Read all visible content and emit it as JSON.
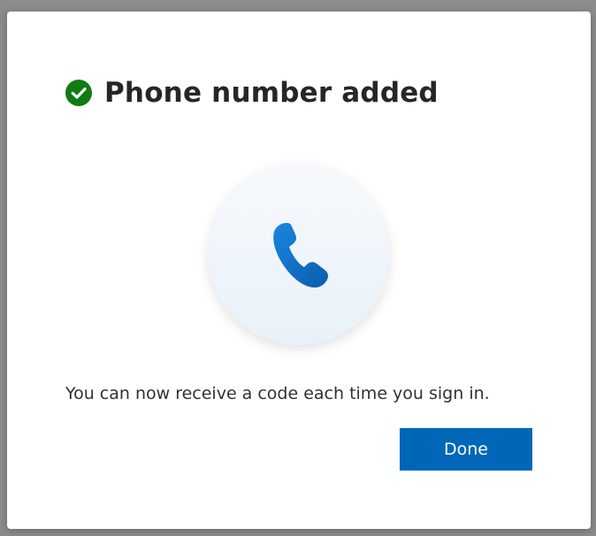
{
  "dialog": {
    "title": "Phone number added",
    "message": "You can now receive a code each time you sign in.",
    "done_label": "Done",
    "status_icon": "check-circle-icon",
    "hero_icon": "phone-icon"
  },
  "colors": {
    "success": "#107c10",
    "accent": "#0067b8",
    "phone_icon": "#0f6cbd"
  }
}
